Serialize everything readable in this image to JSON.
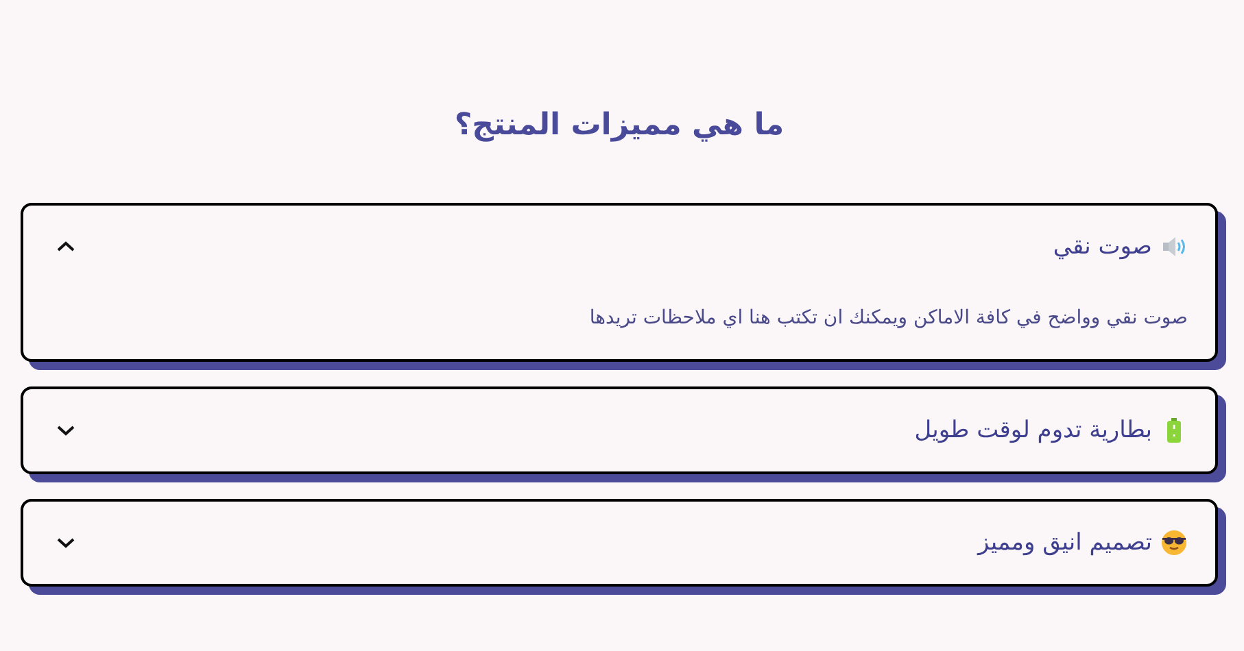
{
  "title": "ما هي مميزات المنتج؟",
  "items": [
    {
      "kind": "speaker",
      "question": "صوت نقي",
      "expanded": true,
      "answer": "صوت نقي وواضح في كافة الاماكن ويمكنك ان تكتب هنا اي ملاحظات تريدها"
    },
    {
      "kind": "battery",
      "question": "بطارية تدوم لوقت طويل",
      "expanded": false
    },
    {
      "kind": "sunglasses",
      "question": "تصميم انيق ومميز",
      "expanded": false
    }
  ]
}
